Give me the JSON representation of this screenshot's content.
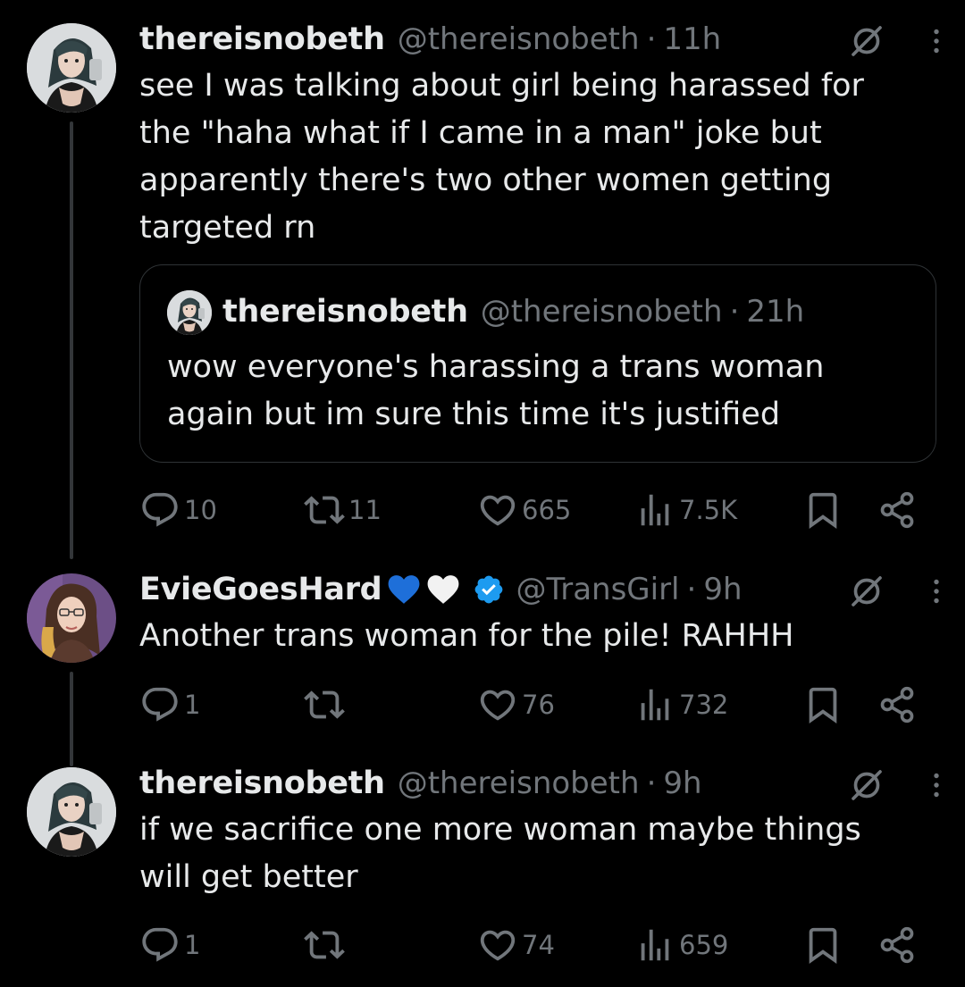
{
  "tweets": [
    {
      "name": "thereisnobeth",
      "handle": "@thereisnobeth",
      "separator": "·",
      "time": "11h",
      "text": "see I was talking about girl being harassed for\nthe \"haha what if I came in a man\" joke but\napparently there's two other women getting\ntargeted rn",
      "quote": {
        "name": "thereisnobeth",
        "handle": "@thereisnobeth",
        "separator": "·",
        "time": "21h",
        "text": "wow everyone's harassing a trans woman\nagain but im sure this time it's justified"
      },
      "replies": "10",
      "reposts": "11",
      "likes": "665",
      "views": "7.5K"
    },
    {
      "name": "EvieGoesHard",
      "handle": "@TransGirl",
      "separator": "·",
      "time": "9h",
      "text": "Another trans woman for the pile! RAHHH",
      "replies": "1",
      "reposts": "",
      "likes": "76",
      "views": "732"
    },
    {
      "name": "thereisnobeth",
      "handle": "@thereisnobeth",
      "separator": "·",
      "time": "9h",
      "text": "if we sacrifice one more woman maybe things\nwill get better",
      "replies": "1",
      "reposts": "",
      "likes": "74",
      "views": "659"
    }
  ],
  "icons": {
    "reply": "reply-icon",
    "repost": "repost-icon",
    "like": "heart-icon",
    "views": "views-icon",
    "bookmark": "bookmark-icon",
    "share": "share-icon",
    "grok": "grok-icon",
    "more": "more-icon",
    "verified": "verified-badge-icon"
  },
  "colors": {
    "background": "#000000",
    "text": "#e7e9ea",
    "secondary": "#71767b",
    "verified": "#1d9bf0",
    "border": "#2f3336"
  }
}
